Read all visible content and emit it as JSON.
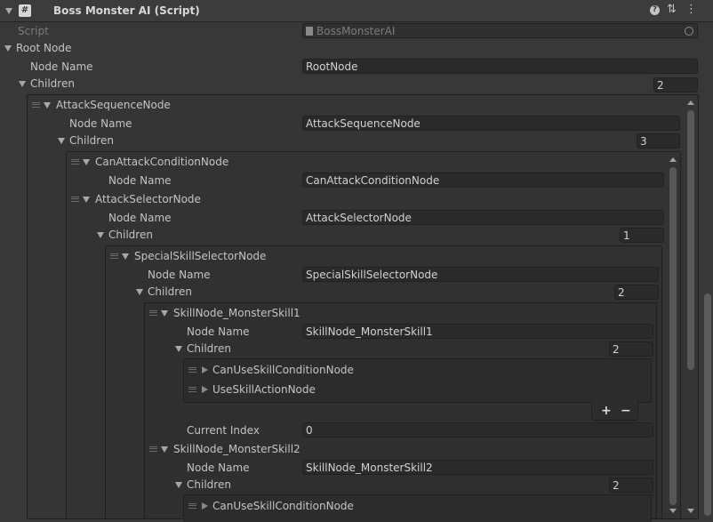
{
  "header": {
    "title": "Boss Monster AI (Script)",
    "script_icon_glyph": "#",
    "help_glyph": "?",
    "settings_glyph": "⇅",
    "menu_glyph": "⋮"
  },
  "script_row": {
    "label": "Script",
    "value": "BossMonsterAI"
  },
  "root": {
    "label": "Root Node",
    "node_name_label": "Node Name",
    "node_name": "RootNode",
    "children_label": "Children",
    "children_count": "2"
  },
  "attack_sequence": {
    "label": "AttackSequenceNode",
    "node_name_label": "Node Name",
    "node_name": "AttackSequenceNode",
    "children_label": "Children",
    "children_count": "3"
  },
  "can_attack": {
    "label": "CanAttackConditionNode",
    "node_name_label": "Node Name",
    "node_name": "CanAttackConditionNode"
  },
  "attack_selector": {
    "label": "AttackSelectorNode",
    "node_name_label": "Node Name",
    "node_name": "AttackSelectorNode",
    "children_label": "Children",
    "children_count": "1"
  },
  "special_selector": {
    "label": "SpecialSkillSelectorNode",
    "node_name_label": "Node Name",
    "node_name": "SpecialSkillSelectorNode",
    "children_label": "Children",
    "children_count": "2"
  },
  "skill1": {
    "label": "SkillNode_MonsterSkill1",
    "node_name_label": "Node Name",
    "node_name": "SkillNode_MonsterSkill1",
    "children_label": "Children",
    "children_count": "2",
    "children": [
      "CanUseSkillConditionNode",
      "UseSkillActionNode"
    ],
    "add_glyph": "+",
    "remove_glyph": "−",
    "current_index_label": "Current Index",
    "current_index": "0"
  },
  "skill2": {
    "label": "SkillNode_MonsterSkill2",
    "node_name_label": "Node Name",
    "node_name": "SkillNode_MonsterSkill2",
    "children_label": "Children",
    "children_count": "2",
    "children": [
      "CanUseSkillConditionNode"
    ]
  },
  "colors": {
    "background": "#383838",
    "field": "#2a2a2a",
    "text": "#c4c4c4"
  }
}
